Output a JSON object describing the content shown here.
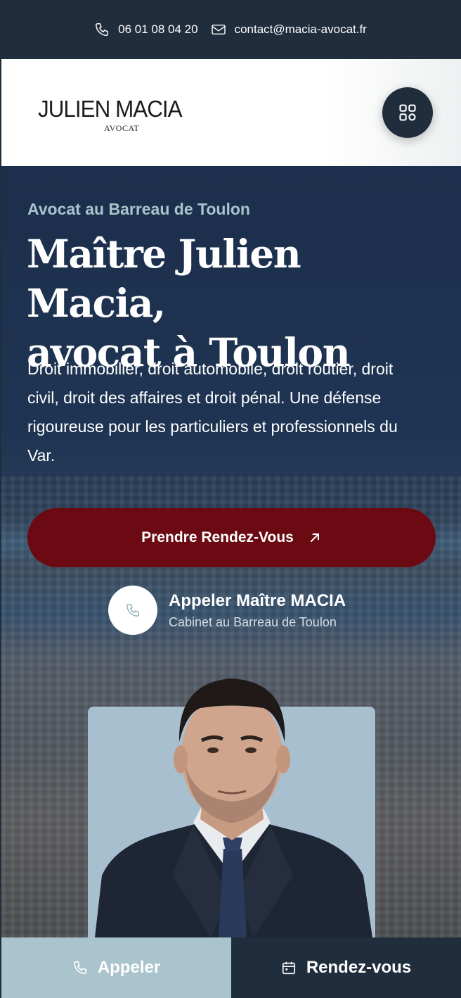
{
  "topbar": {
    "phone": "06 01 08 04 20",
    "email": "contact@macia-avocat.fr",
    "phone_icon": "phone-icon",
    "email_icon": "mail-icon"
  },
  "header": {
    "logo_name": "JULIEN MACIA",
    "logo_sub": "AVOCAT",
    "menu_icon": "grid-menu-icon"
  },
  "hero": {
    "kicker": "Avocat au Barreau de Toulon",
    "title_line1": "Maître Julien Macia,",
    "title_line2": "avocat à Toulon",
    "lead": "Droit immobilier, droit automobile, droit routier, droit civil, droit des affaires et droit pénal. Une défense rigoureuse pour les particuliers et professionnels du Var.",
    "cta_label": "Prendre Rendez-Vous",
    "call_title": "Appeler Maître MACIA",
    "call_subtitle": "Cabinet au Barreau de Toulon"
  },
  "bottom_bar": {
    "call_label": "Appeler",
    "rdv_label": "Rendez-vous"
  },
  "colors": {
    "navy": "#1f2d3c",
    "accent_light": "#a9c4cd",
    "cta_burgundy": "#6b0a12"
  }
}
